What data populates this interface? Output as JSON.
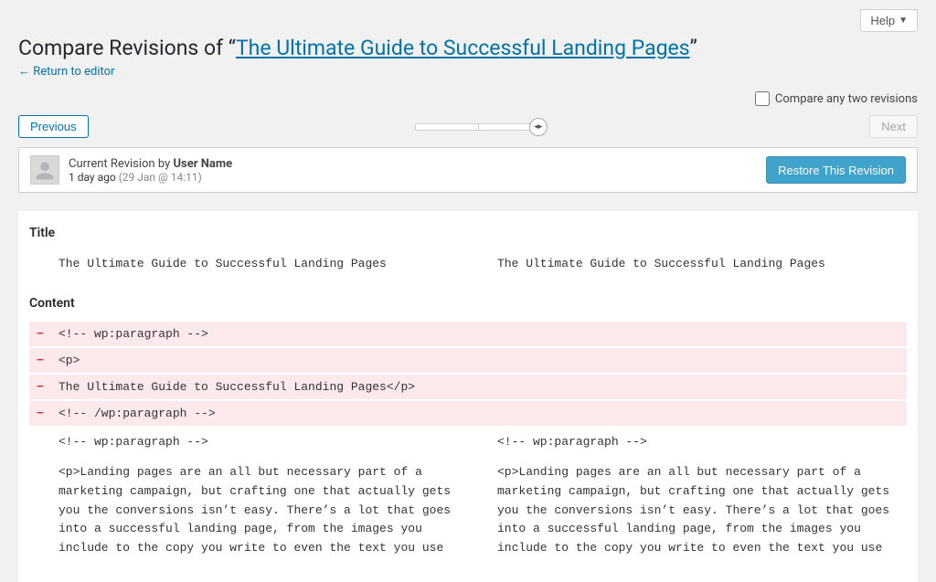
{
  "help_label": "Help",
  "heading_prefix": "Compare Revisions of “",
  "heading_link": "The Ultimate Guide to Successful Landing Pages",
  "heading_suffix": "”",
  "return_link": "← Return to editor",
  "compare_checkbox_label": "Compare any two revisions",
  "nav": {
    "previous": "Previous",
    "next": "Next"
  },
  "revision": {
    "current_by_prefix": "Current Revision by ",
    "user": "User Name",
    "ago": "1 day ago",
    "ts": "(29 Jan @ 14:11)",
    "restore_label": "Restore This Revision"
  },
  "sections": {
    "title_label": "Title",
    "content_label": "Content"
  },
  "diff": {
    "title_left": "The Ultimate Guide to Successful Landing Pages",
    "title_right": "The Ultimate Guide to Successful Landing Pages",
    "removed": [
      "<!-- wp:paragraph -->",
      "<p>",
      "The Ultimate Guide to Successful Landing Pages</p>",
      "<!-- /wp:paragraph -->"
    ],
    "block_open_left": "<!-- wp:paragraph -->",
    "block_open_right": "<!-- wp:paragraph -->",
    "para_left": "<p>Landing pages are an all but necessary part of a marketing campaign, but crafting one that actually gets you the conversions isn’t easy. There’s a lot that goes into a successful landing page, from the images you include to the copy you write to even the text you use",
    "para_right": "<p>Landing pages are an all but necessary part of a marketing campaign, but crafting one that actually gets you the conversions isn’t easy. There’s a lot that goes into a successful landing page, from the images you include to the copy you write to even the text you use"
  }
}
